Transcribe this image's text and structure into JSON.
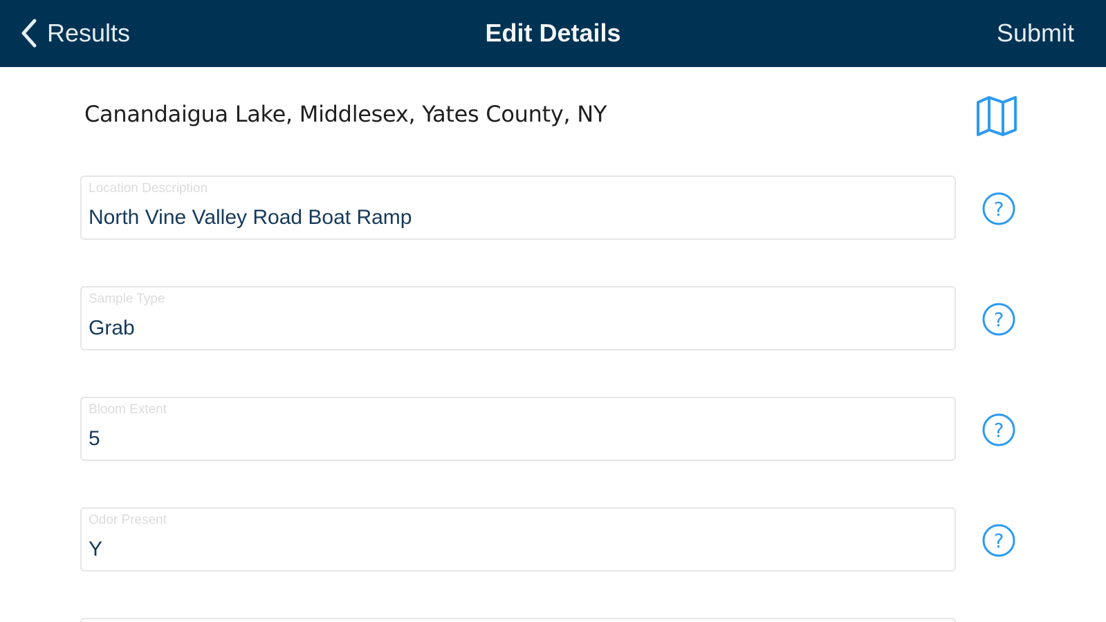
{
  "nav": {
    "back_label": "Results",
    "title": "Edit Details",
    "submit_label": "Submit"
  },
  "location": {
    "name": "Canandaigua Lake, Middlesex, Yates County, NY",
    "map_icon": "map-icon"
  },
  "fields": [
    {
      "label": "Location Description",
      "value": "North Vine Valley Road Boat Ramp"
    },
    {
      "label": "Sample Type",
      "value": "Grab"
    },
    {
      "label": "Bloom Extent",
      "value": "5"
    },
    {
      "label": "Odor Present",
      "value": "Y"
    }
  ],
  "colors": {
    "navbar_bg": "#003253",
    "accent_icon": "#2d9bf0",
    "field_value": "#15395b"
  }
}
